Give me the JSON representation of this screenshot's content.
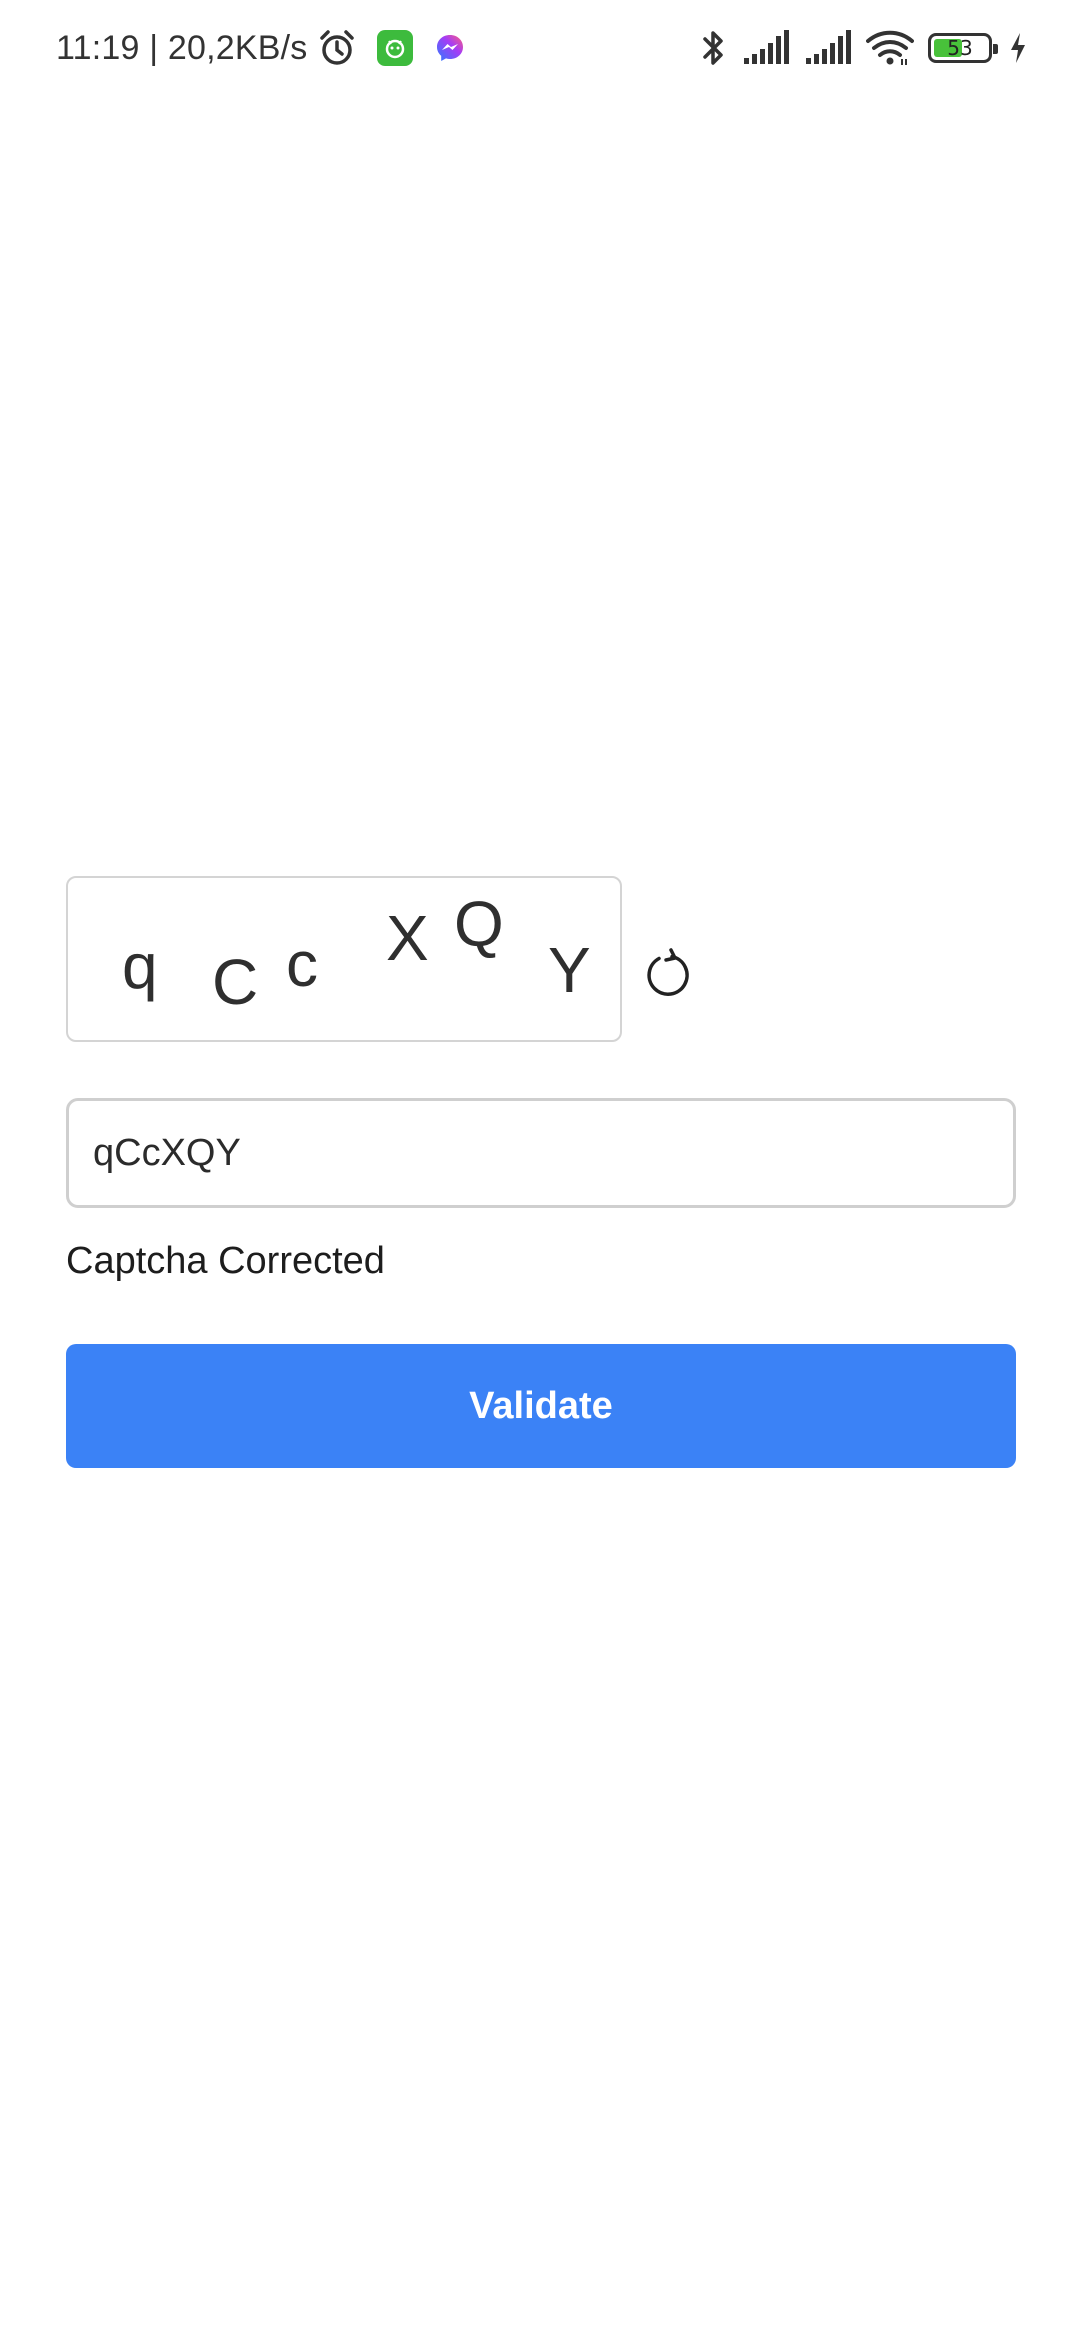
{
  "status_bar": {
    "time_and_speed": "11:19 | 20,2KB/s",
    "battery_level": "53",
    "battery_fraction": 0.53,
    "icons": [
      "alarm-icon",
      "app-notification-icon",
      "messenger-icon",
      "bluetooth-icon",
      "signal-icon",
      "signal-icon",
      "wifi-icon",
      "battery-icon",
      "charging-icon"
    ]
  },
  "captcha": {
    "chars": [
      "q",
      "C",
      "c",
      "X",
      "Q",
      "Y"
    ],
    "refresh_icon": "refresh-icon"
  },
  "input": {
    "value": "qCcXQY"
  },
  "status_message": "Captcha Corrected",
  "validate_button": {
    "label": "Validate",
    "color": "#3b82f6"
  }
}
